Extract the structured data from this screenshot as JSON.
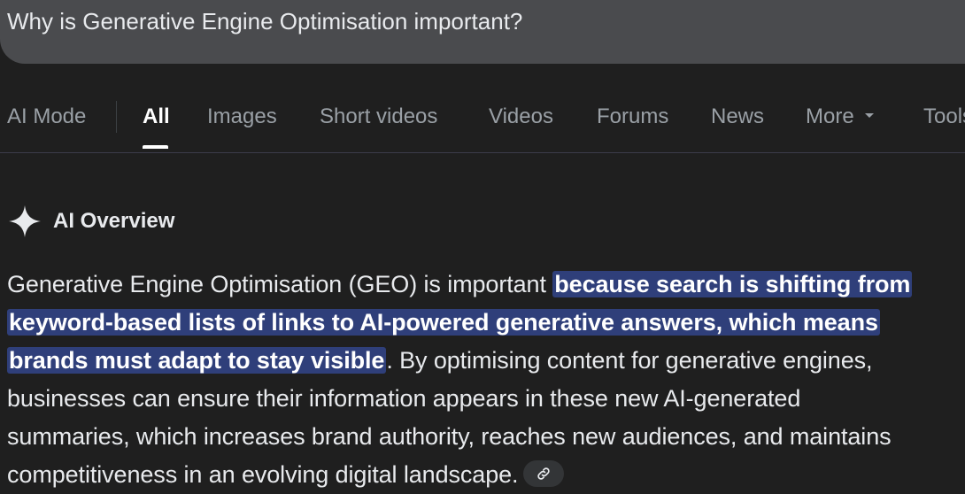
{
  "search": {
    "query": "Why is Generative Engine Optimisation important?"
  },
  "tabs": [
    {
      "label": "AI Mode"
    },
    {
      "label": "All"
    },
    {
      "label": "Images"
    },
    {
      "label": "Short videos"
    },
    {
      "label": "Videos"
    },
    {
      "label": "Forums"
    },
    {
      "label": "News"
    },
    {
      "label": "More"
    },
    {
      "label": "Tools"
    }
  ],
  "ai_overview": {
    "title": "AI Overview",
    "lines": [
      {
        "plain": "Generative Engine Optimisation (GEO) is important ",
        "highlight": "because search is shifting from"
      },
      {
        "highlight": "keyword-based lists of links to AI-powered generative answers, which means"
      },
      {
        "highlight": "brands must adapt to stay visible",
        "plain": ". By optimising content for generative engines,"
      },
      {
        "plain": "businesses can ensure their information appears in these new AI-generated"
      },
      {
        "plain": "summaries, which increases brand authority, reaches new audiences, and maintains"
      },
      {
        "plain": "competitiveness in an evolving digital landscape."
      }
    ]
  },
  "icons": {
    "sparkle": "sparkle-icon",
    "link": "link-icon",
    "dropdown": "chevron-down-icon"
  },
  "colors": {
    "background": "#1f1f1f",
    "search_box": "#4a4b4e",
    "highlight": "#2f3f7a"
  }
}
